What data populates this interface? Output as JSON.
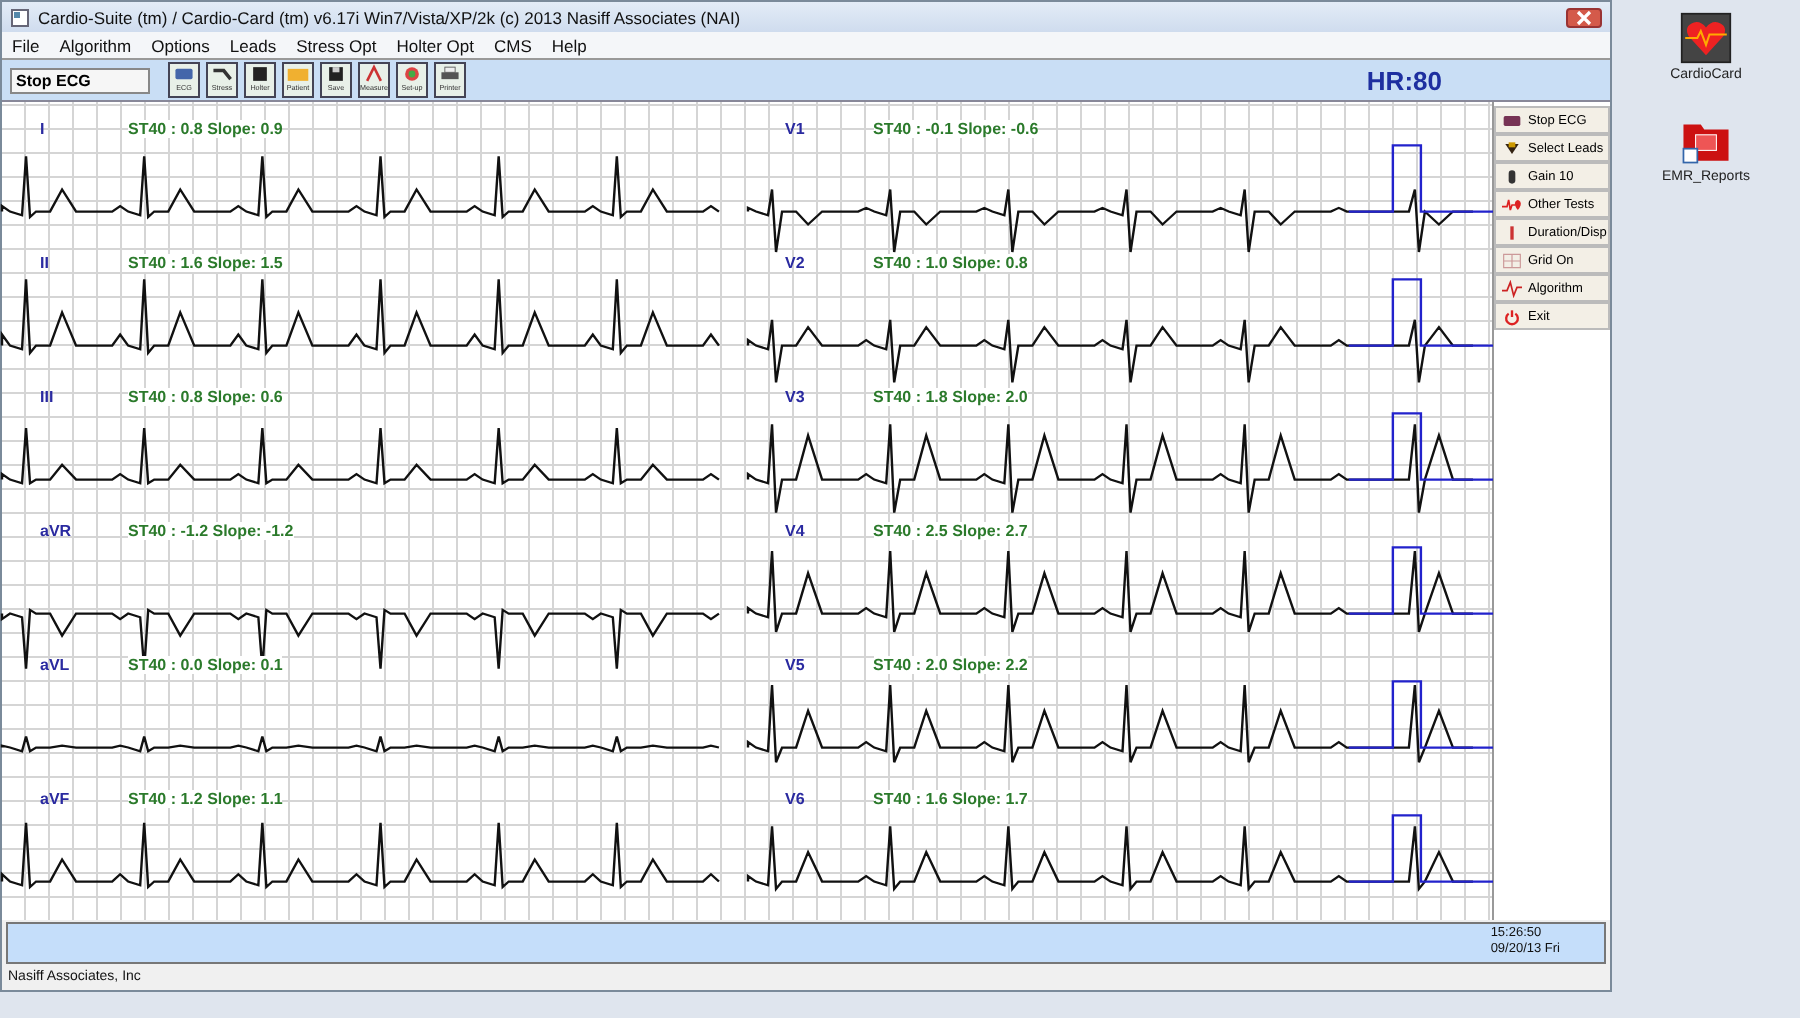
{
  "window": {
    "title": "Cardio-Suite (tm) / Cardio-Card (tm) v6.17i Win7/Vista/XP/2k (c) 2013 Nasiff Associates (NAI)"
  },
  "menu": [
    "File",
    "Algorithm",
    "Options",
    "Leads",
    "Stress Opt",
    "Holter Opt",
    "CMS",
    "Help"
  ],
  "toolbar": {
    "status_field": "Stop ECG",
    "buttons": [
      {
        "label": "ECG",
        "kind": "ecg"
      },
      {
        "label": "Stress",
        "kind": "stress"
      },
      {
        "label": "Holter",
        "kind": "holter"
      },
      {
        "label": "Patient",
        "kind": "patient"
      },
      {
        "label": "Save",
        "kind": "save"
      },
      {
        "label": "Measure",
        "kind": "measure"
      },
      {
        "label": "Set-up",
        "kind": "setup"
      },
      {
        "label": "Printer",
        "kind": "printer"
      }
    ],
    "heart_rate": "HR:80"
  },
  "limb_leads": [
    {
      "name": "I",
      "measure": "ST40 : 0.8 Slope: 0.9"
    },
    {
      "name": "II",
      "measure": "ST40 : 1.6 Slope: 1.5"
    },
    {
      "name": "III",
      "measure": "ST40 : 0.8 Slope: 0.6"
    },
    {
      "name": "aVR",
      "measure": "ST40 : -1.2 Slope: -1.2"
    },
    {
      "name": "aVL",
      "measure": "ST40 : 0.0 Slope: 0.1"
    },
    {
      "name": "aVF",
      "measure": "ST40 : 1.2 Slope: 1.1"
    }
  ],
  "chest_leads": [
    {
      "name": "V1",
      "measure": "ST40 : -0.1 Slope: -0.6"
    },
    {
      "name": "V2",
      "measure": "ST40 : 1.0 Slope: 0.8"
    },
    {
      "name": "V3",
      "measure": "ST40 : 1.8 Slope: 2.0"
    },
    {
      "name": "V4",
      "measure": "ST40 : 2.5 Slope: 2.7"
    },
    {
      "name": "V5",
      "measure": "ST40 : 2.0 Slope: 2.2"
    },
    {
      "name": "V6",
      "measure": "ST40 : 1.6 Slope: 1.7"
    }
  ],
  "side_buttons": [
    {
      "label": "Stop ECG",
      "kind": "ecg"
    },
    {
      "label": "Select Leads",
      "kind": "leads"
    },
    {
      "label": "Gain 10",
      "kind": "gain"
    },
    {
      "label": "Other Tests",
      "kind": "tests"
    },
    {
      "label": "Duration/Disp",
      "kind": "duration"
    },
    {
      "label": "Grid On",
      "kind": "grid"
    },
    {
      "label": "Algorithm",
      "kind": "algorithm"
    },
    {
      "label": "Exit",
      "kind": "exit"
    }
  ],
  "status_bar": {
    "time": "15:26:50",
    "date": "09/20/13 Fri"
  },
  "footer": "Nasiff Associates, Inc",
  "desktop_icons": [
    {
      "label": "CardioCard",
      "kind": "heart"
    },
    {
      "label": "EMR_Reports",
      "kind": "folder"
    }
  ]
}
